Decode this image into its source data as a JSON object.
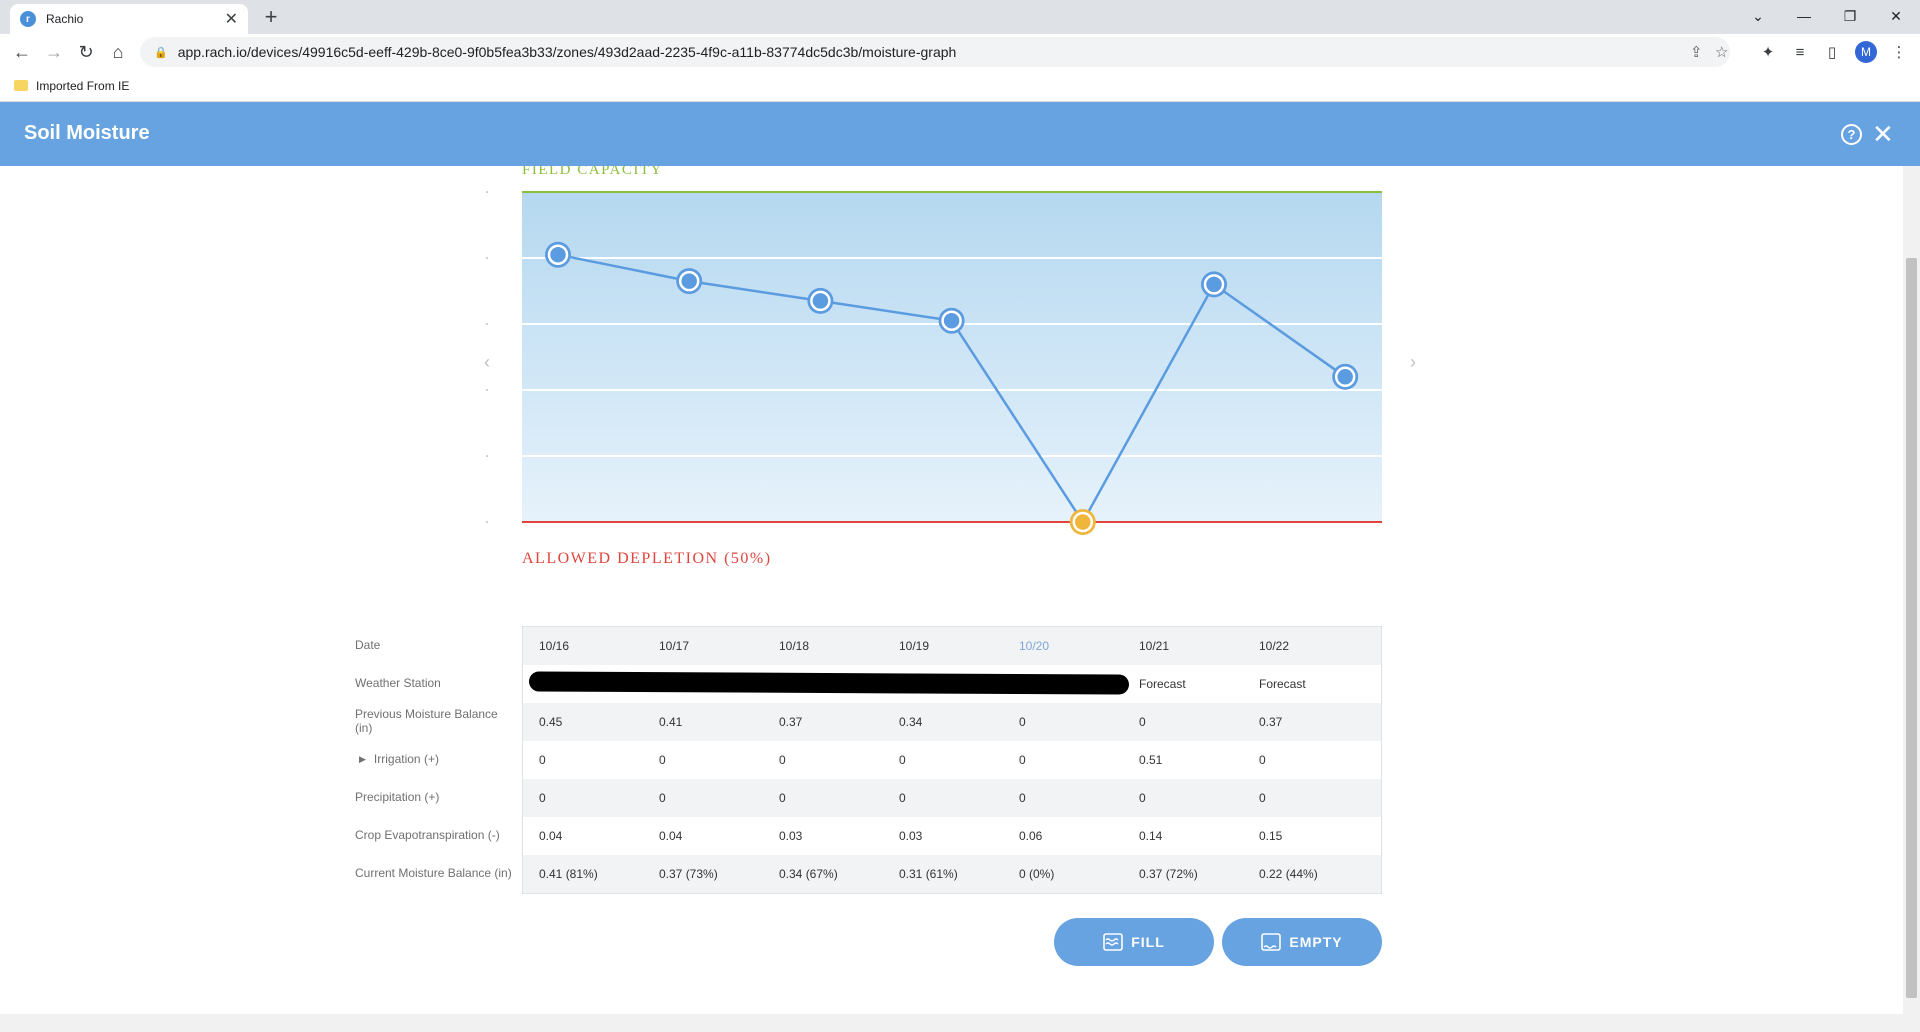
{
  "browser": {
    "tab_title": "Rachio",
    "favicon_letter": "r",
    "url": "app.rach.io/devices/49916c5d-eeff-429b-8ce0-9f0b5fea3b33/zones/493d2aad-2235-4f9c-a11b-83774dc5dc3b/moisture-graph",
    "bookmark": "Imported From IE",
    "profile_initial": "M"
  },
  "app": {
    "title": "Soil Moisture",
    "colors": {
      "header": "#66a3e0",
      "field_capacity": "#8bbf3c",
      "depletion": "#e0453d",
      "forecast_point": "#f0b63c"
    }
  },
  "chart_data": {
    "type": "line",
    "x": [
      "10/16",
      "10/17",
      "10/18",
      "10/19",
      "10/20",
      "10/21",
      "10/22"
    ],
    "series": [
      {
        "values": [
          81,
          73,
          67,
          61,
          0,
          72,
          44
        ]
      }
    ],
    "ylabel": "",
    "ylim": [
      0,
      100
    ],
    "highlighted_point": "10/20",
    "annotations": {
      "top": "FIELD CAPACITY",
      "bottom": "ALLOWED DEPLETION (50%)"
    }
  },
  "table": {
    "dates": [
      "10/16",
      "10/17",
      "10/18",
      "10/19",
      "10/20",
      "10/21",
      "10/22"
    ],
    "active_date": "10/20",
    "rows": [
      {
        "label": "Weather Station",
        "cells": [
          "",
          "",
          "",
          "",
          "",
          "Forecast",
          "Forecast"
        ]
      },
      {
        "label": "Previous Moisture Balance (in)",
        "cells": [
          "0.45",
          "0.41",
          "0.37",
          "0.34",
          "0",
          "0",
          "0.37"
        ]
      },
      {
        "label": "Irrigation (+)",
        "cells": [
          "0",
          "0",
          "0",
          "0",
          "0",
          "0.51",
          "0"
        ]
      },
      {
        "label": "Precipitation (+)",
        "cells": [
          "0",
          "0",
          "0",
          "0",
          "0",
          "0",
          "0"
        ]
      },
      {
        "label": "Crop Evapotranspiration (-)",
        "cells": [
          "0.04",
          "0.04",
          "0.03",
          "0.03",
          "0.06",
          "0.14",
          "0.15"
        ]
      },
      {
        "label": "Current Moisture Balance (in)",
        "cells": [
          "0.41 (81%)",
          "0.37 (73%)",
          "0.34 (67%)",
          "0.31 (61%)",
          "0 (0%)",
          "0.37 (72%)",
          "0.22 (44%)"
        ]
      }
    ],
    "date_label": "Date"
  },
  "actions": {
    "fill": "FILL",
    "empty": "EMPTY"
  }
}
